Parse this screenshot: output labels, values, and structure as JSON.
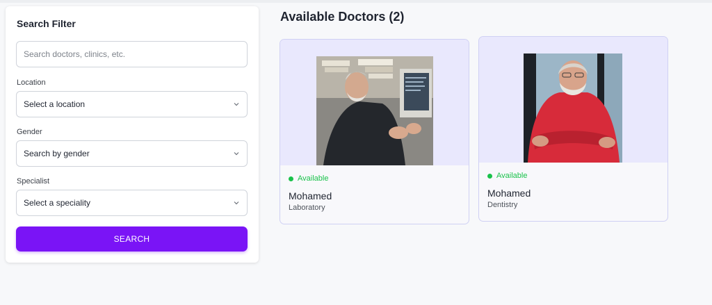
{
  "filter": {
    "title": "Search Filter",
    "search_placeholder": "Search doctors, clinics, etc.",
    "location_label": "Location",
    "location_value": "Select a location",
    "gender_label": "Gender",
    "gender_value": "Search by gender",
    "specialist_label": "Specialist",
    "specialist_value": "Select a speciality",
    "search_button": "SEARCH"
  },
  "results": {
    "title": "Available Doctors (2)",
    "doctors": [
      {
        "status": "Available",
        "name": "Mohamed",
        "specialty": "Laboratory"
      },
      {
        "status": "Available",
        "name": "Mohamed",
        "specialty": "Dentistry"
      }
    ]
  },
  "colors": {
    "accent": "#7a14f6",
    "available": "#19c24a",
    "card_photo_bg": "#e9e8fd"
  },
  "icons": {
    "dropdown": "chevron-down-icon",
    "status": "available-dot-icon"
  }
}
